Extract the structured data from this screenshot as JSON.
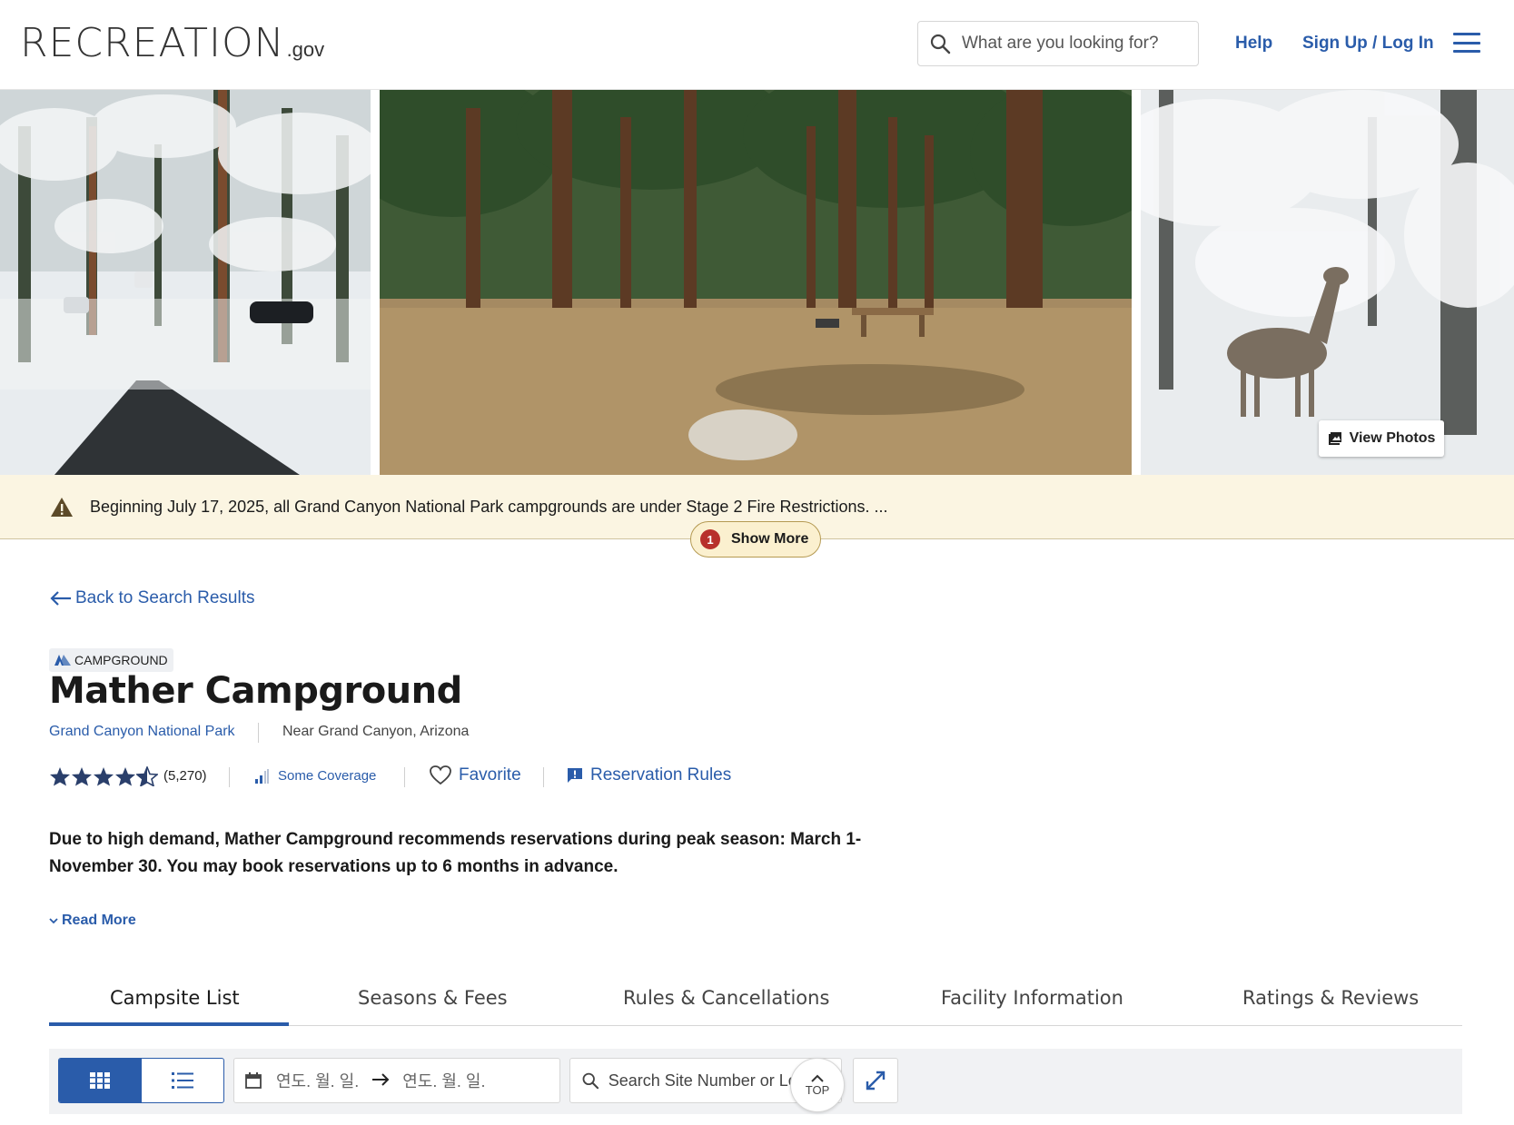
{
  "header": {
    "logo_text": "RECREATION",
    "logo_suffix": ".gov",
    "search_placeholder": "What are you looking for?",
    "help_label": "Help",
    "signup_label": "Sign Up / Log In"
  },
  "hero": {
    "view_photos_label": "View Photos"
  },
  "alert": {
    "text": "Beginning July 17, 2025, all Grand Canyon National Park campgrounds are under Stage 2 Fire Restrictions. ...",
    "show_more_count": "1",
    "show_more_label": "Show More"
  },
  "nav": {
    "back_label": "Back to Search Results"
  },
  "facility": {
    "type": "CAMPGROUND",
    "name": "Mather Campground",
    "park": "Grand Canyon National Park",
    "location": "Near Grand Canyon, Arizona",
    "rating": 4.5,
    "rating_count": "(5,270)",
    "coverage_label": "Some Coverage",
    "favorite_label": "Favorite",
    "reservation_rules_label": "Reservation Rules",
    "description": "Due to high demand, Mather Campground recommends reservations during peak season: March 1-November 30. You may book reservations up to 6 months in advance.",
    "read_more_label": "Read More"
  },
  "tabs": [
    {
      "label": "Campsite List",
      "active": true
    },
    {
      "label": "Seasons & Fees",
      "active": false
    },
    {
      "label": "Rules & Cancellations",
      "active": false
    },
    {
      "label": "Facility Information",
      "active": false
    },
    {
      "label": "Ratings & Reviews",
      "active": false
    }
  ],
  "toolbar": {
    "date_start_placeholder": "연도. 월. 일.",
    "date_end_placeholder": "연도. 월. 일.",
    "site_search_placeholder": "Search Site Number or Loop",
    "top_label": "TOP"
  },
  "colors": {
    "brand_blue": "#2a5caa",
    "alert_bg": "#fbf5e2",
    "alert_badge": "#b8302b"
  }
}
